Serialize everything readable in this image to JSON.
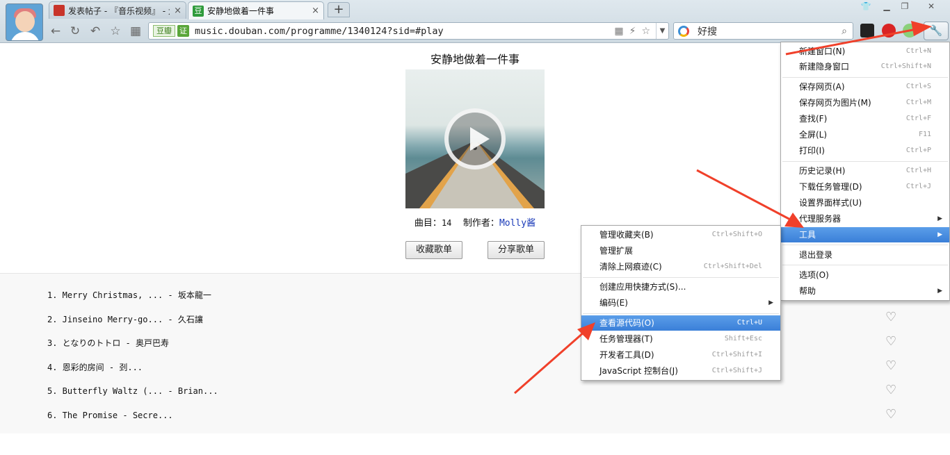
{
  "browser": {
    "tabs": [
      {
        "title": "发表帖子 - 『音乐视频』 - 大",
        "close": "×"
      },
      {
        "title": "安静地做着一件事",
        "close": "×"
      }
    ],
    "new_tab": "+",
    "address": {
      "douban_badge": "豆瓣",
      "cert_badge": "证",
      "url": "music.douban.com/programme/1340124?sid=#play"
    },
    "search": {
      "engine_label": "好搜"
    }
  },
  "page": {
    "title": "安静地做着一件事",
    "meta": {
      "tracks_label": "曲目：",
      "tracks_count": "14",
      "creator_label": "制作者：",
      "creator_name": "Molly酱"
    },
    "buttons": {
      "collect": "收藏歌单",
      "share": "分享歌单"
    },
    "tracks": [
      "1. Merry Christmas, ... - 坂本龍一",
      "2. Jinseino Merry-go... - 久石讓",
      "3. となりのトトロ - 奥戸巴寿",
      "4. 恩彩的房间 - 刭...",
      "5. Butterfly Waltz (... - Brian...",
      "6. The Promise - Secre..."
    ]
  },
  "main_menu": {
    "items": [
      {
        "label": "新建窗口(N)",
        "shortcut": "Ctrl+N"
      },
      {
        "label": "新建隐身窗口",
        "shortcut": "Ctrl+Shift+N"
      },
      {
        "label": "保存网页(A)",
        "shortcut": "Ctrl+S"
      },
      {
        "label": "保存网页为图片(M)",
        "shortcut": "Ctrl+M"
      },
      {
        "label": "查找(F)",
        "shortcut": "Ctrl+F"
      },
      {
        "label": "全屏(L)",
        "shortcut": "F11"
      },
      {
        "label": "打印(I)",
        "shortcut": "Ctrl+P"
      },
      {
        "label": "历史记录(H)",
        "shortcut": "Ctrl+H"
      },
      {
        "label": "下载任务管理(D)",
        "shortcut": "Ctrl+J"
      },
      {
        "label": "设置界面样式(U)",
        "shortcut": ""
      },
      {
        "label": "代理服务器",
        "shortcut": ""
      },
      {
        "label": "工具",
        "shortcut": ""
      },
      {
        "label": "退出登录",
        "shortcut": ""
      },
      {
        "label": "选项(O)",
        "shortcut": ""
      },
      {
        "label": "帮助",
        "shortcut": ""
      }
    ]
  },
  "tools_menu": {
    "items": [
      {
        "label": "管理收藏夹(B)",
        "shortcut": "Ctrl+Shift+O"
      },
      {
        "label": "管理扩展",
        "shortcut": ""
      },
      {
        "label": "清除上网痕迹(C)",
        "shortcut": "Ctrl+Shift+Del"
      },
      {
        "label": "创建应用快捷方式(S)...",
        "shortcut": ""
      },
      {
        "label": "编码(E)",
        "shortcut": ""
      },
      {
        "label": "查看源代码(O)",
        "shortcut": "Ctrl+U"
      },
      {
        "label": "任务管理器(T)",
        "shortcut": "Shift+Esc"
      },
      {
        "label": "开发者工具(D)",
        "shortcut": "Ctrl+Shift+I"
      },
      {
        "label": "JavaScript 控制台(J)",
        "shortcut": "Ctrl+Shift+J"
      }
    ]
  },
  "colors": {
    "highlight": "#3a7fd8",
    "arrow": "#f0402a",
    "link": "#1a3ab8"
  }
}
